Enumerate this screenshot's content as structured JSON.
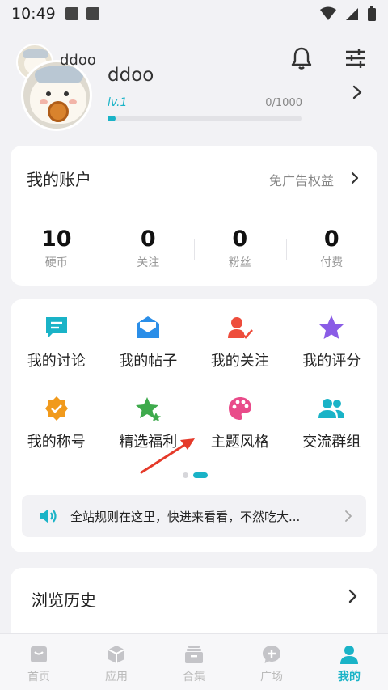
{
  "status_bar": {
    "time": "10:49"
  },
  "profile": {
    "secondary_name": "ddoo",
    "username": "ddoo",
    "level": "lv.1",
    "xp_text": "0/1000",
    "xp_progress": 0.04
  },
  "account": {
    "title": "我的账户",
    "perk_label": "免广告权益",
    "stats": [
      {
        "value": "10",
        "label": "硬币"
      },
      {
        "value": "0",
        "label": "关注"
      },
      {
        "value": "0",
        "label": "粉丝"
      },
      {
        "value": "0",
        "label": "付费"
      }
    ]
  },
  "menu": {
    "items": [
      {
        "label": "我的讨论",
        "icon": "chat-icon",
        "color": "#1ab3c7"
      },
      {
        "label": "我的帖子",
        "icon": "mail-icon",
        "color": "#2a8ee8"
      },
      {
        "label": "我的关注",
        "icon": "user-check-icon",
        "color": "#ee4d3c"
      },
      {
        "label": "我的评分",
        "icon": "star-icon",
        "color": "#8a5ce6"
      },
      {
        "label": "我的称号",
        "icon": "badge-icon",
        "color": "#f19a1c"
      },
      {
        "label": "精选福利",
        "icon": "stars-icon",
        "color": "#3eaa4c"
      },
      {
        "label": "主题风格",
        "icon": "palette-icon",
        "color": "#e94b8a"
      },
      {
        "label": "交流群组",
        "icon": "group-icon",
        "color": "#1ab3c7"
      }
    ],
    "notice": "全站规则在这里，快进来看看，不然吃大..."
  },
  "history": {
    "title": "浏览历史"
  },
  "bottom_nav": [
    {
      "label": "首页",
      "icon": "home-icon",
      "active": false
    },
    {
      "label": "应用",
      "icon": "app-box-icon",
      "active": false
    },
    {
      "label": "合集",
      "icon": "collection-icon",
      "active": false
    },
    {
      "label": "广场",
      "icon": "plaza-icon",
      "active": false
    },
    {
      "label": "我的",
      "icon": "profile-icon",
      "active": true
    }
  ],
  "colors": {
    "accent": "#1ab3c7",
    "annotation_arrow": "#e53a2a"
  }
}
